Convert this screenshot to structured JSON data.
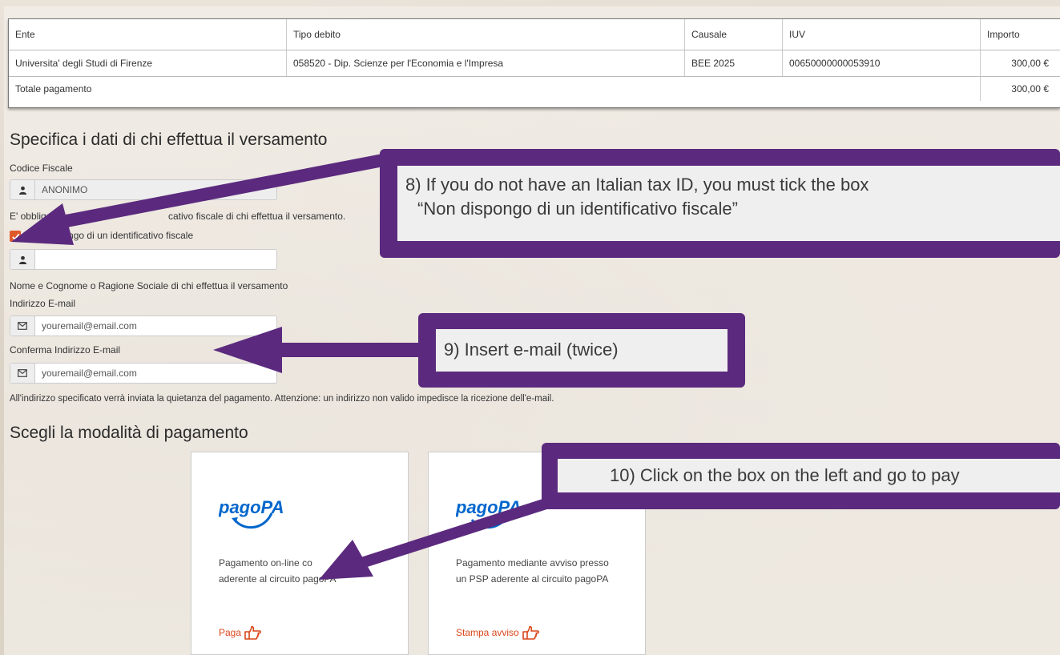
{
  "table": {
    "headers": [
      "Ente",
      "Tipo debito",
      "Causale",
      "IUV",
      "Importo"
    ],
    "row": {
      "ente": "Universita' degli Studi di Firenze",
      "tipo_debito": "058520 - Dip. Scienze per l'Economia e l'Impresa",
      "causale": "BEE 2025",
      "iuv": "00650000000053910",
      "importo": "300,00 €"
    },
    "total": {
      "label": "Totale pagamento",
      "amount": "300,00 €"
    }
  },
  "payer": {
    "title": "Specifica i dati di chi effettua il versamento",
    "cf_label": "Codice Fiscale",
    "cf_value": "ANONIMO",
    "cf_note": "E' obbligatorio",
    "cf_note_tail": "cativo fiscale di chi effettua il versamento.",
    "no_tax_id_label": "Non dispongo di un identificativo fiscale",
    "no_tax_id_checked": true,
    "name_value": "",
    "name_label": "Nome e Cognome o Ragione Sociale di chi effettua il versamento",
    "email_label": "Indirizzo E-mail",
    "email_value": "youremail@email.com",
    "confirm_email_label": "Conferma Indirizzo E-mail",
    "confirm_email_value": "youremail@email.com",
    "receipt_note": "All'indirizzo specificato verrà inviata la quietanza del pagamento. Attenzione: un indirizzo non valido impedisce la ricezione dell'e-mail."
  },
  "payment": {
    "title": "Scegli la modalità di pagamento",
    "logo_text": "pagoPA",
    "online": {
      "desc_line1": "Pagamento on-line co",
      "desc_line2": "aderente al circuito pagoPA",
      "action": "Paga"
    },
    "notice": {
      "desc": "Pagamento mediante avviso presso un PSP aderente al circuito pagoPA",
      "action": "Stampa avviso"
    }
  },
  "callouts": {
    "c8_line1": "8) If you do not have an Italian tax ID, you must tick the box",
    "c8_line2": "“Non dispongo di un identificativo fiscale”",
    "c9": "9) Insert e-mail (twice)",
    "c10": "10) Click on the box on the left and go to pay"
  },
  "colors": {
    "callout": "#5b2a7e",
    "accent": "#d9461a",
    "pagopa": "#0066cc"
  },
  "icons": {
    "user": "user-icon",
    "mail": "envelope-icon",
    "hand": "pointing-hand-icon",
    "check": "check-icon"
  }
}
